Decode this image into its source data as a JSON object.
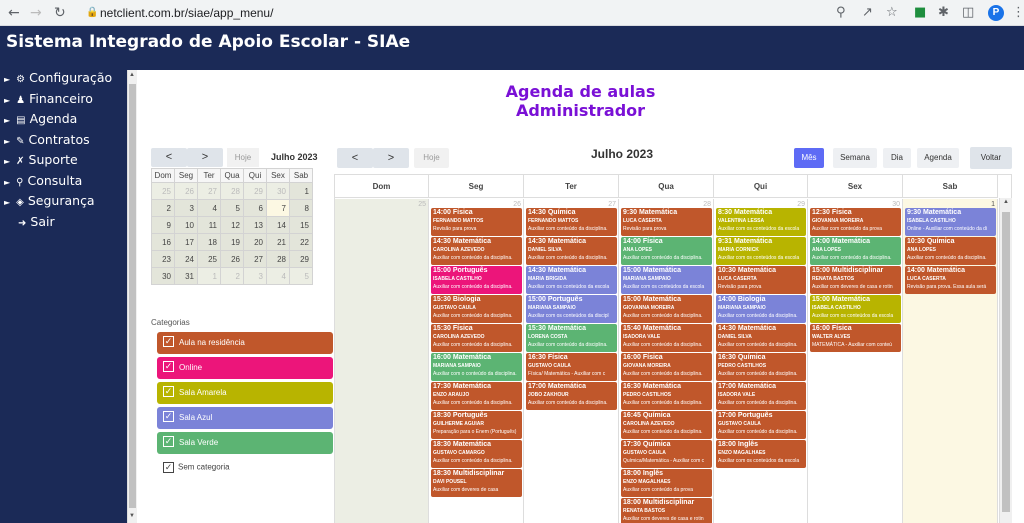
{
  "browser": {
    "url": "netclient.com.br/siae/app_menu/",
    "profile": "P",
    "back_icon": "arrow-left",
    "forward_icon": "arrow-right",
    "reload_icon": "reload",
    "lock_icon": "lock"
  },
  "app": {
    "title": "Sistema Integrado de Apoio Escolar - SIAe"
  },
  "menu": [
    {
      "label": "Configuração",
      "icon": "gear"
    },
    {
      "label": "Financeiro",
      "icon": "person-money"
    },
    {
      "label": "Agenda",
      "icon": "book"
    },
    {
      "label": "Contratos",
      "icon": "document"
    },
    {
      "label": "Suporte",
      "icon": "wrench"
    },
    {
      "label": "Consulta",
      "icon": "search"
    },
    {
      "label": "Segurança",
      "icon": "lock"
    },
    {
      "label": "Sair",
      "icon": "logout"
    }
  ],
  "page": {
    "title_line1": "Agenda de aulas",
    "title_line2": "Administrador"
  },
  "minical": {
    "prev": "<",
    "next": ">",
    "today": "Hoje",
    "title": "Julho 2023",
    "days": [
      "Dom",
      "Seg",
      "Ter",
      "Qua",
      "Qui",
      "Sex",
      "Sab"
    ],
    "weeks": [
      [
        "25",
        "26",
        "27",
        "28",
        "29",
        "30",
        "1"
      ],
      [
        "2",
        "3",
        "4",
        "5",
        "6",
        "7",
        "8"
      ],
      [
        "9",
        "10",
        "11",
        "12",
        "13",
        "14",
        "15"
      ],
      [
        "16",
        "17",
        "18",
        "19",
        "20",
        "21",
        "22"
      ],
      [
        "23",
        "24",
        "25",
        "26",
        "27",
        "28",
        "29"
      ],
      [
        "30",
        "31",
        "1",
        "2",
        "3",
        "4",
        "5"
      ]
    ]
  },
  "categories": {
    "label": "Categorias",
    "items": [
      {
        "label": "Aula na residência",
        "color": "#c0572b"
      },
      {
        "label": "Online",
        "color": "#ec157a"
      },
      {
        "label": "Sala Amarela",
        "color": "#b8b400"
      },
      {
        "label": "Sala Azul",
        "color": "#7b83d8"
      },
      {
        "label": "Sala Verde",
        "color": "#5cb473"
      }
    ],
    "none_label": "Sem categoria"
  },
  "calendar": {
    "prev": "<",
    "next": ">",
    "today": "Hoje",
    "month": "Julho 2023",
    "views": [
      "Mês",
      "Semana",
      "Dia",
      "Agenda"
    ],
    "active_view": "Mês",
    "back": "Voltar",
    "days": [
      "Dom",
      "Seg",
      "Ter",
      "Qua",
      "Qui",
      "Sex",
      "Sab"
    ],
    "daynums": [
      "25",
      "26",
      "27",
      "28",
      "29",
      "30",
      "1"
    ],
    "events": [
      [],
      [
        {
          "t": "14:00 Física",
          "p": "FERNANDO MATTOS",
          "n": "Revisão para prova",
          "c": "#c0572b"
        },
        {
          "t": "14:30 Matemática",
          "p": "CAROLINA AZEVEDO",
          "n": "Auxiliar com conteúdo da disciplina.",
          "c": "#c0572b"
        },
        {
          "t": "15:00 Português",
          "p": "ISABELA CASTILHO",
          "n": "Auxiliar com conteúdo da disciplina.",
          "c": "#ec157a"
        },
        {
          "t": "15:30 Biologia",
          "p": "GUSTAVO CAULA",
          "n": "Auxiliar com conteúdo da disciplina.",
          "c": "#c0572b"
        },
        {
          "t": "15:30 Física",
          "p": "CAROLINA AZEVEDO",
          "n": "Auxiliar com conteúdo da disciplina.",
          "c": "#c0572b"
        },
        {
          "t": "16:00 Matemática",
          "p": "MARIANA SAMPAIO",
          "n": "Auxiliar com o conteúdo da disciplina.",
          "c": "#5cb473"
        },
        {
          "t": "17:30 Matemática",
          "p": "ENZO ARAUJO",
          "n": "Auxiliar com conteúdo da disciplina.",
          "c": "#c0572b"
        },
        {
          "t": "18:30 Português",
          "p": "GUILHERME AGUIAR",
          "n": "Preparação para o Enem (Português)",
          "c": "#c0572b"
        },
        {
          "t": "18:30 Matemática",
          "p": "GUSTAVO CAMARGO",
          "n": "Auxiliar com conteúdo da disciplina.",
          "c": "#c0572b"
        },
        {
          "t": "18:30 Multidisciplinar",
          "p": "DAVI POUSEL",
          "n": "Auxiliar com deveres de casa",
          "c": "#c0572b"
        }
      ],
      [
        {
          "t": "14:30 Química",
          "p": "FERNANDO MATTOS",
          "n": "Auxiliar com conteúdo da disciplina.",
          "c": "#c0572b"
        },
        {
          "t": "14:30 Matemática",
          "p": "DANIEL SILVA",
          "n": "Auxiliar com conteúdo da disciplina.",
          "c": "#c0572b"
        },
        {
          "t": "14:30 Matemática",
          "p": "MARIA BRIGIDA",
          "n": "Auxiliar com os conteúdos da escola",
          "c": "#7b83d8"
        },
        {
          "t": "15:00 Português",
          "p": "MARIANA SAMPAIO",
          "n": "Auxiliar com os conteúdos da discipl",
          "c": "#7b83d8"
        },
        {
          "t": "15:30 Matemática",
          "p": "LORENA COSTA",
          "n": "Auxiliar com conteúdo da disciplina.",
          "c": "#5cb473"
        },
        {
          "t": "16:30 Física",
          "p": "GUSTAVO CAULA",
          "n": "Física/ Matemática - Auxiliar com c",
          "c": "#c0572b"
        },
        {
          "t": "17:00 Matemática",
          "p": "JOBO ZAKHOUR",
          "n": "Auxiliar com conteúdo da disciplina.",
          "c": "#c0572b"
        }
      ],
      [
        {
          "t": "9:30 Matemática",
          "p": "LUCA CASERTA",
          "n": "Revisão para prova",
          "c": "#c0572b"
        },
        {
          "t": "14:00 Física",
          "p": "ANA LOPES",
          "n": "Auxiliar com conteúdo da disciplina.",
          "c": "#5cb473"
        },
        {
          "t": "15:00 Matemática",
          "p": "MARIANA SAMPAIO",
          "n": "Auxiliar com os conteúdos da escola",
          "c": "#7b83d8"
        },
        {
          "t": "15:00 Matemática",
          "p": "GIOVANNA MOREIRA",
          "n": "Auxiliar com conteúdo da disciplina.",
          "c": "#c0572b"
        },
        {
          "t": "15:40 Matemática",
          "p": "ISADORA VALE",
          "n": "Auxiliar com conteúdo da disciplina.",
          "c": "#c0572b"
        },
        {
          "t": "16:00 Física",
          "p": "GIOVANA MOREIRA",
          "n": "Auxiliar com conteúdo da disciplina.",
          "c": "#c0572b"
        },
        {
          "t": "16:30 Matemática",
          "p": "PEDRO CASTILHOS",
          "n": "Auxiliar com conteúdo da disciplina.",
          "c": "#c0572b"
        },
        {
          "t": "16:45 Química",
          "p": "CAROLINA AZEVEDO",
          "n": "Auxiliar com conteúdo da disciplina.",
          "c": "#c0572b"
        },
        {
          "t": "17:30 Química",
          "p": "GUSTAVO CAULA",
          "n": "Química/Matemática - Auxiliar com c",
          "c": "#c0572b"
        },
        {
          "t": "18:00 Inglês",
          "p": "ENZO MAGALHAES",
          "n": "Auxiliar com conteúdo da prova",
          "c": "#c0572b"
        },
        {
          "t": "18:00 Multidisciplinar",
          "p": "RENATA BASTOS",
          "n": "Auxiliar com deveres de casa e rotin",
          "c": "#c0572b"
        }
      ],
      [
        {
          "t": "8:30 Matemática",
          "p": "VALENTINA LESSA",
          "n": "Auxiliar com os conteúdos da escola",
          "c": "#b8b400"
        },
        {
          "t": "9:31 Matemática",
          "p": "MARIA CORNICK",
          "n": "Auxiliar com os conteúdos da escola",
          "c": "#b8b400"
        },
        {
          "t": "10:30 Matemática",
          "p": "LUCA CASERTA",
          "n": "Revisão para prova",
          "c": "#c0572b"
        },
        {
          "t": "14:00 Biologia",
          "p": "MARIANA SAMPAIO",
          "n": "Auxiliar com conteúdo da disciplina.",
          "c": "#7b83d8"
        },
        {
          "t": "14:30 Matemática",
          "p": "DANIEL SILVA",
          "n": "Auxiliar com conteúdo da disciplina.",
          "c": "#c0572b"
        },
        {
          "t": "16:30 Química",
          "p": "PEDRO CASTILHOS",
          "n": "Auxiliar com conteúdo da disciplina.",
          "c": "#c0572b"
        },
        {
          "t": "17:00 Matemática",
          "p": "ISADORA VALE",
          "n": "Auxiliar com conteúdo da disciplina.",
          "c": "#c0572b"
        },
        {
          "t": "17:00 Português",
          "p": "GUSTAVO CAULA",
          "n": "Auxiliar com conteúdo da disciplina.",
          "c": "#c0572b"
        },
        {
          "t": "18:00 Inglês",
          "p": "ENZO MAGALHAES",
          "n": "Auxiliar com os conteúdos da escola",
          "c": "#c0572b"
        }
      ],
      [
        {
          "t": "12:30 Física",
          "p": "GIOVANNA MOREIRA",
          "n": "Auxiliar com conteúdo da prova",
          "c": "#c0572b"
        },
        {
          "t": "14:00 Matemática",
          "p": "ANA LOPES",
          "n": "Auxiliar com conteúdo da disciplina.",
          "c": "#5cb473"
        },
        {
          "t": "15:00 Multidisciplinar",
          "p": "RENATA BASTOS",
          "n": "Auxiliar com deveres de casa e rotin",
          "c": "#c0572b"
        },
        {
          "t": "15:00 Matemática",
          "p": "ISABELA CASTILHO",
          "n": "Auxiliar com os conteúdos da escola",
          "c": "#b8b400"
        },
        {
          "t": "16:00 Física",
          "p": "WALTER ALVES",
          "n": "MATEMÁTICA - Auxiliar com conteú",
          "c": "#c0572b"
        }
      ],
      [
        {
          "t": "9:30 Matemática",
          "p": "ISABELA CASTILHO",
          "n": "Online - Auxiliar com conteúdo da di",
          "c": "#7b83d8"
        },
        {
          "t": "10:30 Química",
          "p": "ANA LOPES",
          "n": "Auxiliar com conteúdo da disciplina.",
          "c": "#c0572b"
        },
        {
          "t": "14:00 Matemática",
          "p": "LUCA CASERTA",
          "n": "Revisão para prova. Essa aula será",
          "c": "#c0572b"
        }
      ]
    ]
  }
}
